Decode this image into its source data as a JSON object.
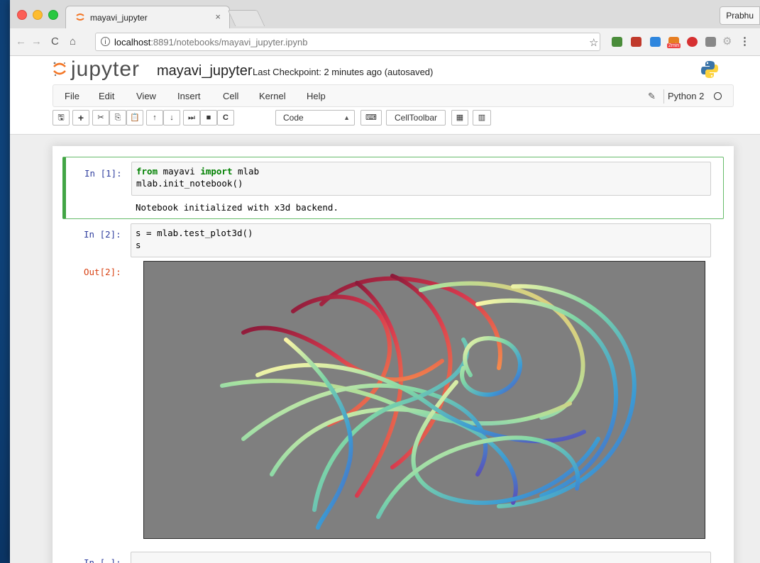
{
  "browser": {
    "tab_title": "mayavi_jupyter",
    "tab_close": "×",
    "profile_name": "Prabhu",
    "url_host": "localhost",
    "url_rest": ":8891/notebooks/mayavi_jupyter.ipynb",
    "extension_badge": "2min"
  },
  "jupyter": {
    "logo_text": "jupyter",
    "notebook_name": "mayavi_jupyter",
    "checkpoint": "Last Checkpoint: 2 minutes ago (autosaved)",
    "menu": [
      "File",
      "Edit",
      "View",
      "Insert",
      "Cell",
      "Kernel",
      "Help"
    ],
    "kernel_name": "Python 2",
    "toolbar": {
      "cell_type": "Code",
      "celltoolbar_label": "CellToolbar"
    }
  },
  "cells": [
    {
      "prompt": "In [1]:",
      "code_line1_kw1": "from",
      "code_line1_mid": " mayavi ",
      "code_line1_kw2": "import",
      "code_line1_end": " mlab",
      "code_line2": "mlab.init_notebook()",
      "output": "Notebook initialized with x3d backend."
    },
    {
      "prompt": "In [2]:",
      "code_line1": "s = mlab.test_plot3d()",
      "code_line2": "s",
      "out_prompt": "Out[2]:"
    },
    {
      "prompt": "In [ ]:"
    }
  ],
  "colors": {
    "selected_cell_border": "#42a545",
    "in_prompt": "#303f9f",
    "out_prompt": "#d84315",
    "plot_background": "#7f7f7f"
  }
}
